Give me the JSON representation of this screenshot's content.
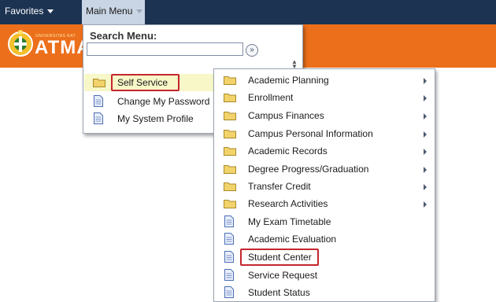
{
  "topnav": {
    "favorites_label": "Favorites",
    "main_menu_label": "Main Menu"
  },
  "brand": {
    "logo_small_text": "UNIVERSITAS KAT",
    "logo_text": "ATMA",
    "color": "#ec6f1b"
  },
  "search": {
    "title": "Search Menu:",
    "value": "",
    "placeholder": "",
    "go_glyph": "»"
  },
  "main_menu_items": [
    {
      "label": "Self Service",
      "icon": "folder-icon",
      "selected": true
    },
    {
      "label": "Change My Password",
      "icon": "document-icon",
      "selected": false
    },
    {
      "label": "My System Profile",
      "icon": "document-icon",
      "selected": false
    }
  ],
  "self_service_submenu": [
    {
      "label": "Academic Planning",
      "icon": "folder-icon",
      "has_submenu": true
    },
    {
      "label": "Enrollment",
      "icon": "folder-icon",
      "has_submenu": true
    },
    {
      "label": "Campus Finances",
      "icon": "folder-icon",
      "has_submenu": true
    },
    {
      "label": "Campus Personal Information",
      "icon": "folder-icon",
      "has_submenu": true
    },
    {
      "label": "Academic Records",
      "icon": "folder-icon",
      "has_submenu": true
    },
    {
      "label": "Degree Progress/Graduation",
      "icon": "folder-icon",
      "has_submenu": true
    },
    {
      "label": "Transfer Credit",
      "icon": "folder-icon",
      "has_submenu": true
    },
    {
      "label": "Research Activities",
      "icon": "folder-icon",
      "has_submenu": true
    },
    {
      "label": "My Exam Timetable",
      "icon": "document-icon",
      "has_submenu": false
    },
    {
      "label": "Academic Evaluation",
      "icon": "document-icon",
      "has_submenu": false
    },
    {
      "label": "Student Center",
      "icon": "document-icon",
      "has_submenu": false,
      "highlighted": true
    },
    {
      "label": "Service Request",
      "icon": "document-icon",
      "has_submenu": false
    },
    {
      "label": "Student Status",
      "icon": "document-icon",
      "has_submenu": false
    }
  ],
  "colors": {
    "topbar": "#1c3351",
    "highlight_outline": "#c4262e",
    "selected_row": "#f7f7c8"
  }
}
